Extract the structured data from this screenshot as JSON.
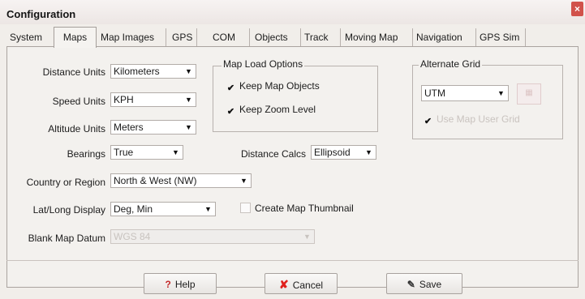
{
  "window": {
    "title": "Configuration",
    "close_symbol": "×"
  },
  "tabs": [
    {
      "label": "System"
    },
    {
      "label": "Maps",
      "active": true
    },
    {
      "label": "Map Images"
    },
    {
      "label": "GPS"
    },
    {
      "label": "COM"
    },
    {
      "label": "Objects"
    },
    {
      "label": "Track"
    },
    {
      "label": "Moving Map"
    },
    {
      "label": "Navigation"
    },
    {
      "label": "GPS Sim"
    }
  ],
  "maps": {
    "distance_units": {
      "label": "Distance Units",
      "value": "Kilometers"
    },
    "speed_units": {
      "label": "Speed Units",
      "value": "KPH"
    },
    "altitude_units": {
      "label": "Altitude Units",
      "value": "Meters"
    },
    "bearings": {
      "label": "Bearings",
      "value": "True"
    },
    "distance_calcs": {
      "label": "Distance Calcs",
      "value": "Ellipsoid"
    },
    "country_region": {
      "label": "Country or Region",
      "value": "North & West (NW)"
    },
    "latlong_display": {
      "label": "Lat/Long Display",
      "value": "Deg, Min"
    },
    "create_thumbnail": {
      "label": "Create Map Thumbnail",
      "checked": false
    },
    "blank_map_datum": {
      "label": "Blank Map Datum",
      "value": "WGS 84"
    },
    "map_load_options": {
      "title": "Map Load Options",
      "keep_map_objects": {
        "label": "Keep Map Objects",
        "checked": true
      },
      "keep_zoom_level": {
        "label": "Keep Zoom Level",
        "checked": true
      }
    },
    "alternate_grid": {
      "title": "Alternate Grid",
      "value": "UTM",
      "use_map_user_grid": {
        "label": "Use Map User Grid",
        "checked": true
      }
    }
  },
  "buttons": {
    "help": {
      "label": "Help",
      "icon": "help-icon"
    },
    "cancel": {
      "label": "Cancel",
      "icon": "cancel-icon"
    },
    "save": {
      "label": "Save",
      "icon": "save-icon"
    }
  },
  "colors": {
    "cancel_red": "#e0201c",
    "help_red": "#c42b2b",
    "close_red": "#d1524b"
  }
}
